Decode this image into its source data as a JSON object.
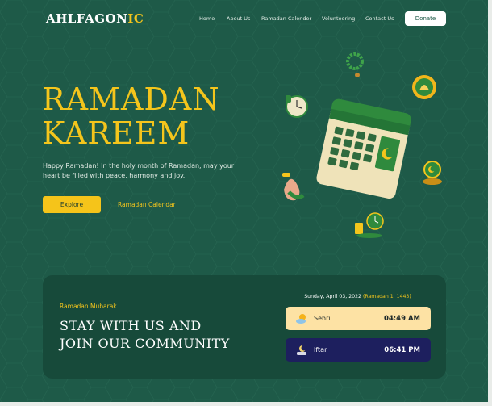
{
  "header": {
    "logo_main": "AHLFAGON",
    "logo_accent": "IC",
    "nav": [
      "Home",
      "About Us",
      "Ramadan Calender",
      "Volunteering",
      "Contact Us"
    ],
    "donate_label": "Donate"
  },
  "hero": {
    "title_line1": "RAMADAN",
    "title_line2": "KAREEM",
    "description": "Happy Ramadan! In the holy month of Ramadan, may your heart be filled with peace, harmony and joy.",
    "explore_label": "Explore",
    "calendar_link": "Ramadan Calendar"
  },
  "card": {
    "eyebrow": "Ramadan Mubarak",
    "title_line1": "STAY WITH US AND",
    "title_line2": "JOIN OUR COMMUNITY",
    "date": "Sunday, April 03, 2022",
    "hijri": "(Ramadan 1, 1443)",
    "sehri_label": "Sehri",
    "sehri_time": "04:49 AM",
    "iftar_label": "Iftar",
    "iftar_time": "06:41 PM"
  },
  "icons": {
    "sehri": "sun-cloud-icon",
    "iftar": "moon-icon"
  },
  "colors": {
    "background": "#1e5a48",
    "card": "#174a3a",
    "accent": "#f4c51c",
    "sehri_bg": "#fde2a4",
    "iftar_bg": "#1d1f5e"
  }
}
